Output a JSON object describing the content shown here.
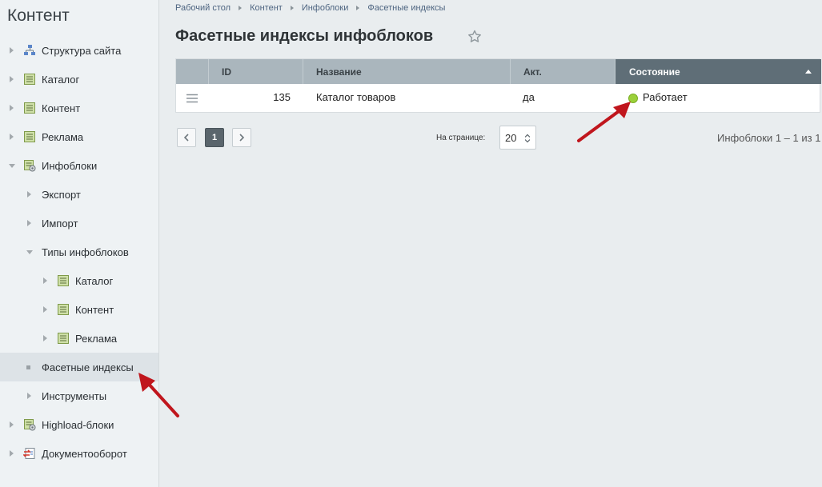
{
  "sidebar": {
    "title": "Контент",
    "items": [
      {
        "label": "Структура сайта"
      },
      {
        "label": "Каталог"
      },
      {
        "label": "Контент"
      },
      {
        "label": "Реклама"
      },
      {
        "label": "Инфоблоки"
      },
      {
        "label": "Экспорт"
      },
      {
        "label": "Импорт"
      },
      {
        "label": "Типы инфоблоков"
      },
      {
        "label": "Каталог"
      },
      {
        "label": "Контент"
      },
      {
        "label": "Реклама"
      },
      {
        "label": "Фасетные индексы"
      },
      {
        "label": "Инструменты"
      },
      {
        "label": "Highload-блоки"
      },
      {
        "label": "Документооборот"
      }
    ]
  },
  "breadcrumb": [
    "Рабочий стол",
    "Контент",
    "Инфоблоки",
    "Фасетные индексы"
  ],
  "page_title": "Фасетные индексы инфоблоков",
  "grid": {
    "columns": [
      "ID",
      "Название",
      "Акт.",
      "Состояние"
    ],
    "rows": [
      {
        "id": "135",
        "name": "Каталог товаров",
        "active": "да",
        "status": "Работает"
      }
    ]
  },
  "pagination": {
    "current_page": "1",
    "per_page_label": "На странице:",
    "per_page_value": "20",
    "total_text": "Инфоблоки 1 – 1 из 1"
  },
  "colors": {
    "status_ok": "#9bd03a",
    "annotation_arrow": "#c0161d"
  }
}
